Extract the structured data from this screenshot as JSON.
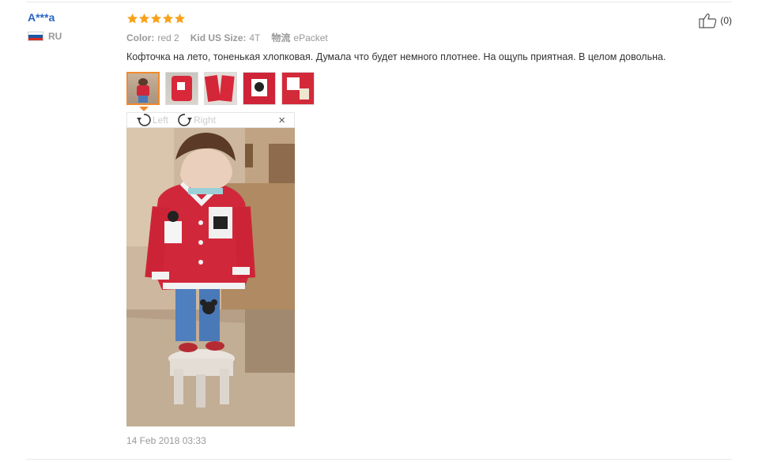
{
  "reviewer": {
    "name": "A***a",
    "country_code": "RU",
    "flag_colors": [
      "#ffffff",
      "#1c57a5",
      "#d52b1e"
    ]
  },
  "review": {
    "rating_stars": 5,
    "star_color": "#f7a21a",
    "color_label": "Color:",
    "color_value": "red 2",
    "size_label": "Kid US Size:",
    "size_value": "4T",
    "shipping_label": "物流",
    "shipping_value": "ePacket",
    "text": "Кофточка на лето, тоненькая хлопковая. Думала что будет немного плотнее. На ощупь приятная. В целом довольна.",
    "helpful_count": "(0)",
    "date": "14 Feb 2018 03:33"
  },
  "viewer": {
    "rotate_left_label": "Left",
    "rotate_right_label": "Right",
    "close_symbol": "×"
  },
  "thumbnails": [
    {
      "name": "photo-1",
      "active": true
    },
    {
      "name": "photo-2",
      "active": false
    },
    {
      "name": "photo-3",
      "active": false
    },
    {
      "name": "photo-4",
      "active": false
    },
    {
      "name": "photo-5",
      "active": false
    }
  ],
  "colors": {
    "accent": "#f08b2d",
    "link": "#2a64c5",
    "muted": "#999999"
  }
}
